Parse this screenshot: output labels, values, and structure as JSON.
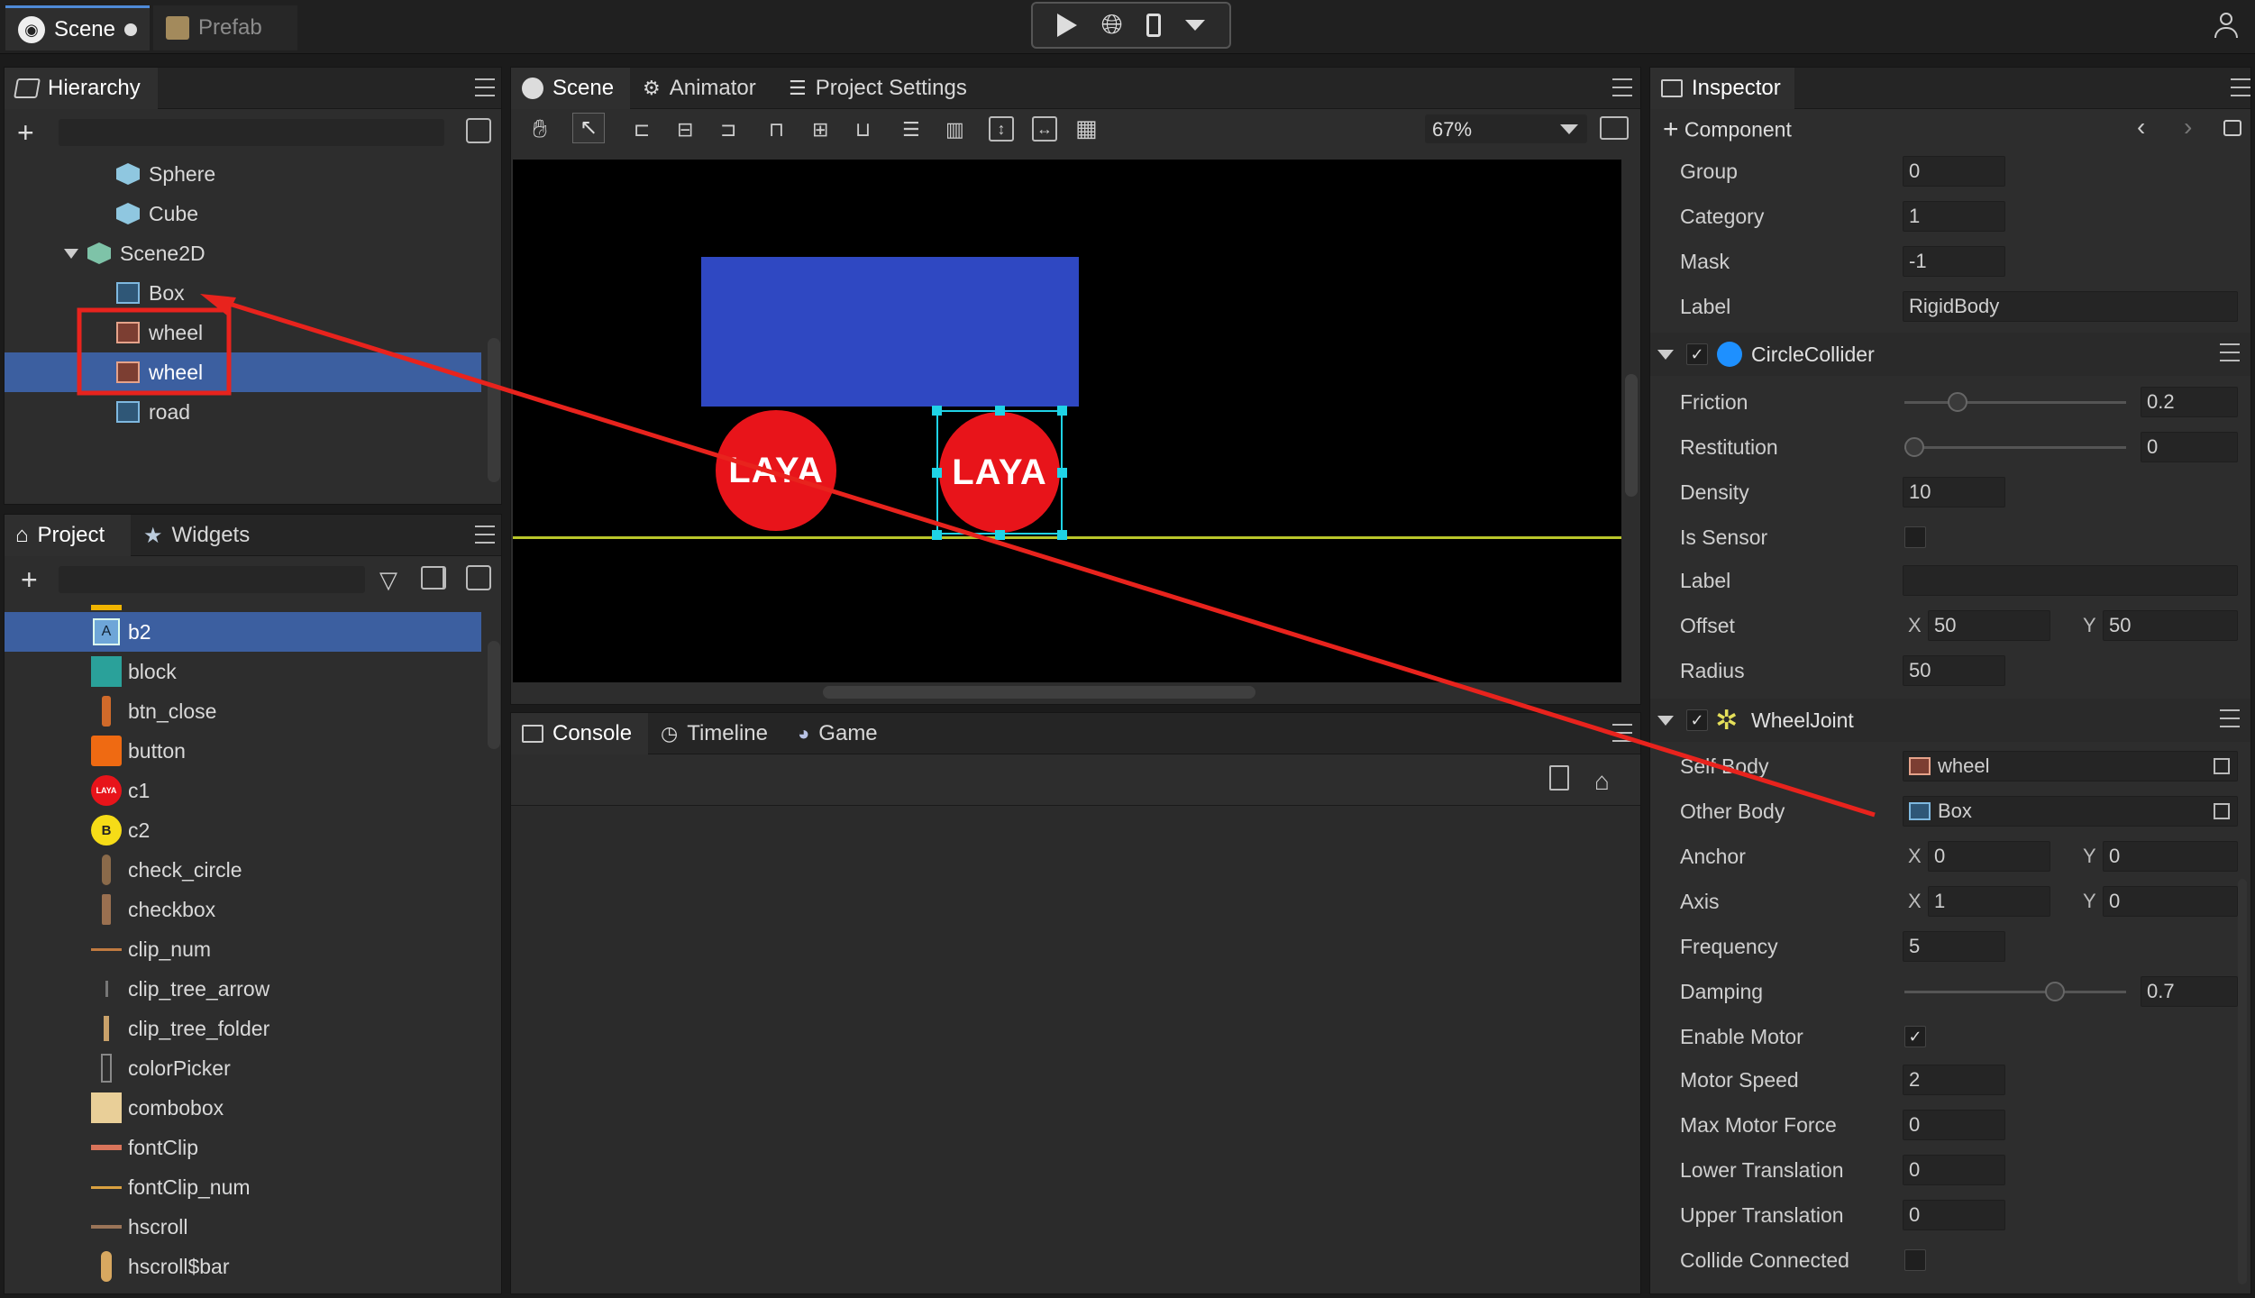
{
  "doc_tabs": [
    {
      "label": "Scene",
      "active": true
    },
    {
      "label": "Prefab",
      "active": false
    }
  ],
  "hierarchy": {
    "tab": "Hierarchy",
    "items": [
      {
        "label": "Sphere",
        "icon": "cube-icon"
      },
      {
        "label": "Cube",
        "icon": "cube-icon"
      },
      {
        "label": "Scene2D",
        "icon": "cube-icon"
      },
      {
        "label": "Box",
        "icon": "box-node-icon"
      },
      {
        "label": "wheel",
        "icon": "image-node-icon"
      },
      {
        "label": "wheel",
        "icon": "image-node-icon",
        "selected": true
      },
      {
        "label": "road",
        "icon": "box-node-icon"
      }
    ]
  },
  "project": {
    "tabs": [
      "Project",
      "Widgets"
    ],
    "items": [
      {
        "label": "b2",
        "selected": true
      },
      {
        "label": "block"
      },
      {
        "label": "btn_close"
      },
      {
        "label": "button"
      },
      {
        "label": "c1"
      },
      {
        "label": "c2"
      },
      {
        "label": "check_circle"
      },
      {
        "label": "checkbox"
      },
      {
        "label": "clip_num"
      },
      {
        "label": "clip_tree_arrow"
      },
      {
        "label": "clip_tree_folder"
      },
      {
        "label": "colorPicker"
      },
      {
        "label": "combobox"
      },
      {
        "label": "fontClip"
      },
      {
        "label": "fontClip_num"
      },
      {
        "label": "hscroll"
      },
      {
        "label": "hscroll$bar"
      }
    ],
    "thumb_text": {
      "b2": "A",
      "c1": "LAYA",
      "c2": "B"
    }
  },
  "scene_panel": {
    "tabs": [
      "Scene",
      "Animator",
      "Project Settings"
    ],
    "zoom": "67%",
    "canvas": {
      "wheel_text_left": "LAYA",
      "wheel_text_right": "LAYA"
    }
  },
  "console_panel": {
    "tabs": [
      "Console",
      "Timeline",
      "Game"
    ]
  },
  "inspector": {
    "tab": "Inspector",
    "component_label": "Component",
    "rigidbody": [
      {
        "label": "Group",
        "value": "0"
      },
      {
        "label": "Category",
        "value": "1"
      },
      {
        "label": "Mask",
        "value": "-1"
      },
      {
        "label": "Label",
        "value": "RigidBody"
      }
    ],
    "circle_collider": {
      "title": "CircleCollider",
      "friction_label": "Friction",
      "friction": "0.2",
      "friction_level": 0.2,
      "restitution_label": "Restitution",
      "restitution": "0",
      "restitution_level": 0,
      "density_label": "Density",
      "density": "10",
      "is_sensor_label": "Is Sensor",
      "label_label": "Label",
      "label_value": "",
      "offset_label": "Offset",
      "offset_x": "50",
      "offset_y": "50",
      "radius_label": "Radius",
      "radius": "50"
    },
    "wheel_joint": {
      "title": "WheelJoint",
      "self_body_label": "Self Body",
      "self_body": "wheel",
      "other_body_label": "Other Body",
      "other_body": "Box",
      "anchor_label": "Anchor",
      "anchor_x": "0",
      "anchor_y": "0",
      "axis_label": "Axis",
      "axis_x": "1",
      "axis_y": "0",
      "frequency_label": "Frequency",
      "frequency": "5",
      "damping_label": "Damping",
      "damping": "0.7",
      "damping_level": 0.7,
      "enable_motor_label": "Enable Motor",
      "motor_speed_label": "Motor Speed",
      "motor_speed": "2",
      "max_motor_force_label": "Max Motor Force",
      "max_motor_force": "0",
      "lower_translation_label": "Lower Translation",
      "lower_translation": "0",
      "upper_translation_label": "Upper Translation",
      "upper_translation": "0",
      "collide_connected_label": "Collide Connected"
    },
    "xy_labels": {
      "x": "X",
      "y": "Y"
    }
  },
  "colors": {
    "accent": "#3c5fa0",
    "annotation": "#e8231d",
    "box_blue": "#2f48c2",
    "wheel_red": "#e8141a",
    "selection": "#1fd3e6",
    "ground": "#b9c62a"
  }
}
